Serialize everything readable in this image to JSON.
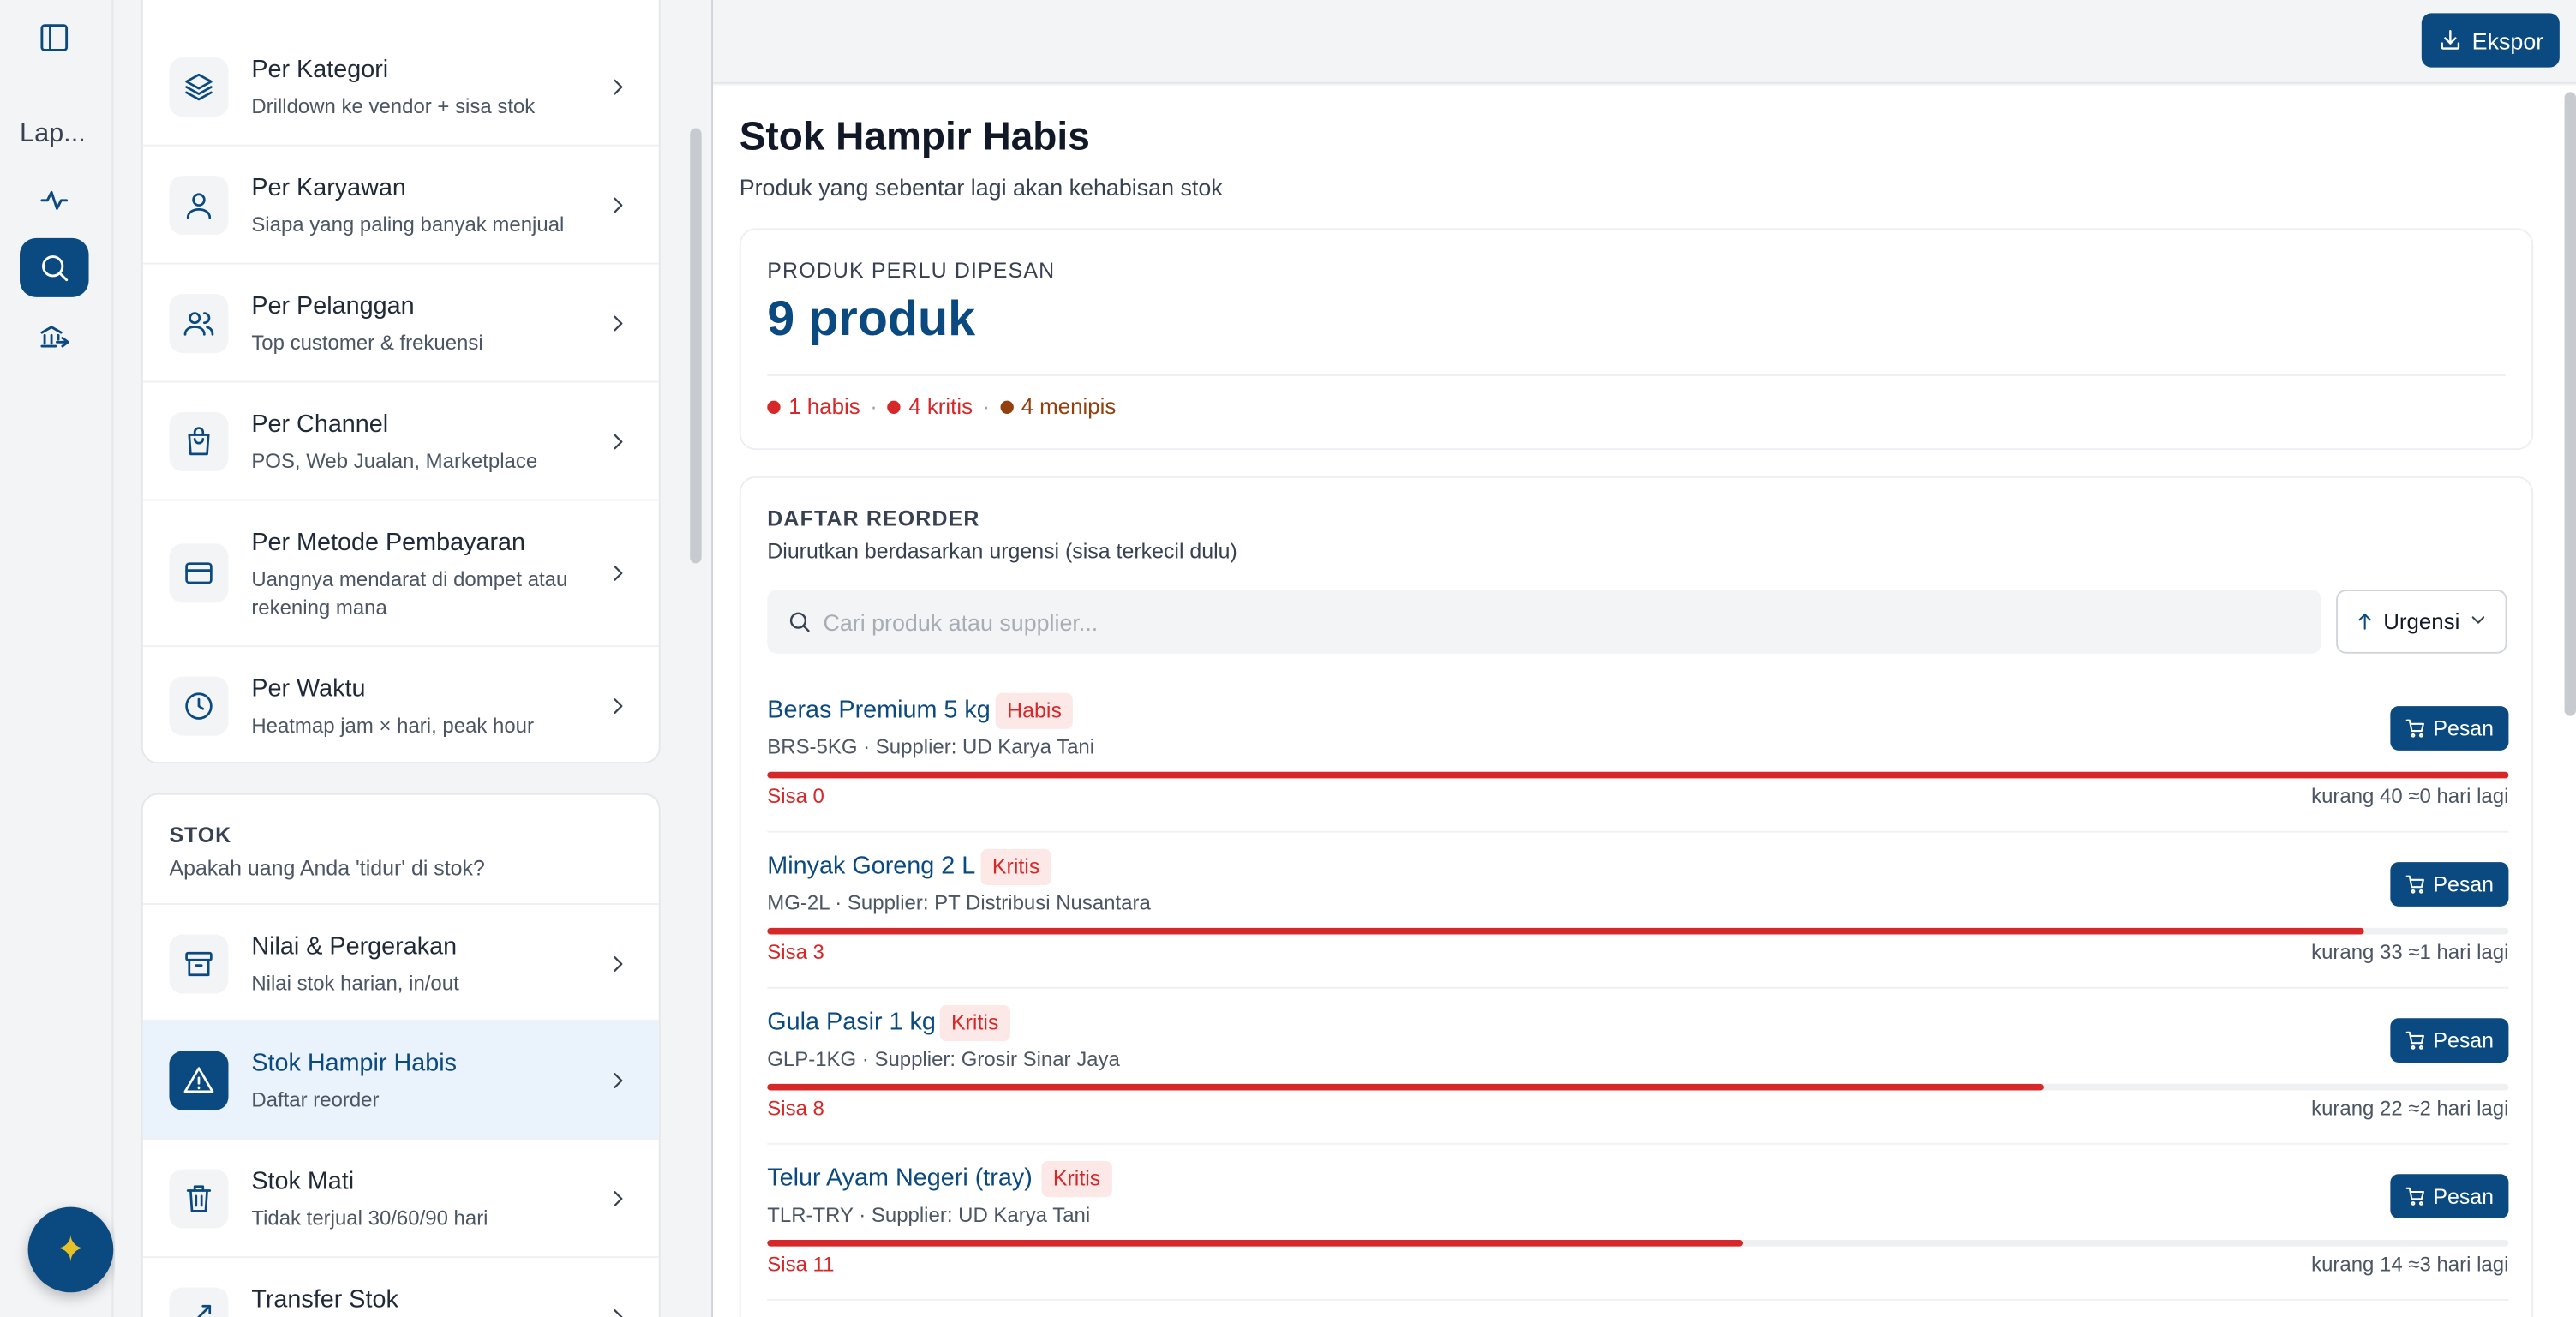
{
  "rail": {
    "label": "Lap..."
  },
  "menu": {
    "items_top": [
      {
        "title": "Per Kategori",
        "sub": "Drilldown ke vendor + sisa stok",
        "icon": "layers-icon"
      },
      {
        "title": "Per Karyawan",
        "sub": "Siapa yang paling banyak menjual",
        "icon": "user-icon"
      },
      {
        "title": "Per Pelanggan",
        "sub": "Top customer & frekuensi",
        "icon": "users-icon"
      },
      {
        "title": "Per Channel",
        "sub": "POS, Web Jualan, Marketplace",
        "icon": "shopping-bag-icon"
      },
      {
        "title": "Per Metode Pembayaran",
        "sub": "Uangnya mendarat di dompet atau rekening mana",
        "icon": "credit-card-icon"
      },
      {
        "title": "Per Waktu",
        "sub": "Heatmap jam × hari, peak hour",
        "icon": "clock-icon"
      }
    ],
    "stok_section": {
      "title": "STOK",
      "sub": "Apakah uang Anda 'tidur' di stok?",
      "items": [
        {
          "title": "Nilai & Pergerakan",
          "sub": "Nilai stok harian, in/out",
          "icon": "archive-icon"
        },
        {
          "title": "Stok Hampir Habis",
          "sub": "Daftar reorder",
          "icon": "warning-icon",
          "active": true
        },
        {
          "title": "Stok Mati",
          "sub": "Tidak terjual 30/60/90 hari",
          "icon": "trash-icon"
        },
        {
          "title": "Transfer Stok",
          "sub": "",
          "icon": "transfer-icon"
        }
      ]
    }
  },
  "topbar": {
    "export_label": "Ekspor"
  },
  "page": {
    "title": "Stok Hampir Habis",
    "subtitle": "Produk yang sebentar lagi akan kehabisan stok"
  },
  "summary": {
    "kicker": "PRODUK PERLU DIPESAN",
    "count_text": "9 produk",
    "chips": [
      {
        "text": "1 habis",
        "color": "#d62828"
      },
      {
        "text": "4 kritis",
        "color": "#d62828"
      },
      {
        "text": "4 menipis",
        "color": "#92400e"
      }
    ]
  },
  "reorder": {
    "kicker": "DAFTAR REORDER",
    "sub": "Diurutkan berdasarkan urgensi (sisa terkecil dulu)",
    "search_placeholder": "Cari produk atau supplier...",
    "sort_label": "Urgensi",
    "order_label": "Pesan",
    "rows": [
      {
        "name": "Beras Premium 5 kg",
        "badge": "Habis",
        "meta": "BRS-5KG · Supplier: UD Karya Tani",
        "sisa": "Sisa 0",
        "kurang": "kurang 40  ≈0 hari lagi",
        "urgency": 1.0
      },
      {
        "name": "Minyak Goreng 2 L",
        "badge": "Kritis",
        "meta": "MG-2L · Supplier: PT Distribusi Nusantara",
        "sisa": "Sisa 3",
        "kurang": "kurang 33  ≈1 hari lagi",
        "urgency": 0.917
      },
      {
        "name": "Gula Pasir 1 kg",
        "badge": "Kritis",
        "meta": "GLP-1KG · Supplier: Grosir Sinar Jaya",
        "sisa": "Sisa 8",
        "kurang": "kurang 22  ≈2 hari lagi",
        "urgency": 0.733
      },
      {
        "name": "Telur Ayam Negeri (tray)",
        "badge": "Kritis",
        "meta": "TLR-TRY · Supplier: UD Karya Tani",
        "sisa": "Sisa 11",
        "kurang": "kurang 14  ≈3 hari lagi",
        "urgency": 0.56
      }
    ]
  }
}
